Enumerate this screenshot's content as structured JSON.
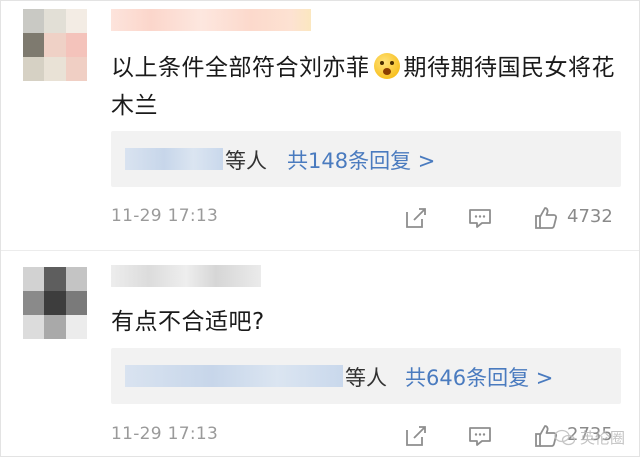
{
  "comments": [
    {
      "text_before_emoji": "以上条件全部符合刘亦菲",
      "emoji": "scream-emoji",
      "text_after_emoji": "期待期待国民女将花木兰",
      "reply_who": "等人",
      "reply_link": "共148条回复 >",
      "timestamp": "11-29 17:13",
      "likes": "4732"
    },
    {
      "text": "有点不合适吧?",
      "reply_who": "等人",
      "reply_link": "共646条回复 >",
      "timestamp": "11-29 17:13",
      "likes": "2735"
    }
  ],
  "watermark": {
    "text": "英伦圈"
  },
  "colors": {
    "link": "#4a7bbf",
    "meta": "#9a9a9a",
    "reply_bg": "#f2f2f2"
  }
}
